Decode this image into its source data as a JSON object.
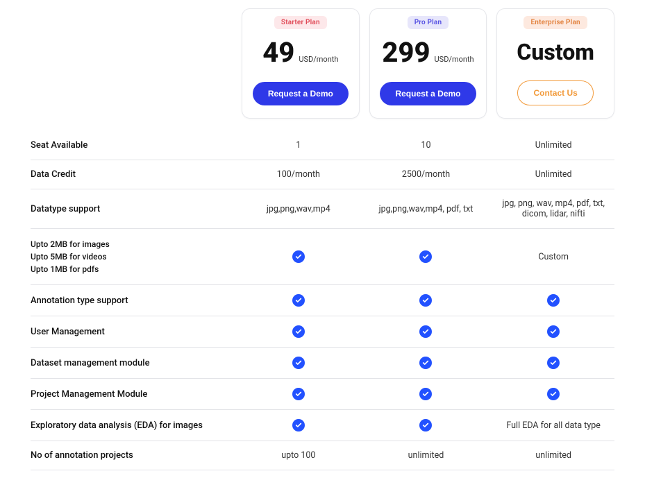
{
  "plans": {
    "starter": {
      "badge": "Starter Plan",
      "price": "49",
      "unit": "USD/month",
      "cta": "Request a Demo"
    },
    "pro": {
      "badge": "Pro Plan",
      "price": "299",
      "unit": "USD/month",
      "cta": "Request a Demo"
    },
    "enterprise": {
      "badge": "Enterprise Plan",
      "price": "Custom",
      "cta": "Contact Us"
    }
  },
  "rows": [
    {
      "label": "Seat Available",
      "starter": "1",
      "pro": "10",
      "enterprise": "Unlimited"
    },
    {
      "label": "Data Credit",
      "starter": "100/month",
      "pro": "2500/month",
      "enterprise": "Unlimited"
    },
    {
      "label": "Datatype support",
      "starter": "jpg,png,wav,mp4",
      "pro": "jpg,png,wav,mp4, pdf, txt",
      "enterprise": "jpg, png, wav, mp4, pdf, txt, dicom, lidar, nifti"
    },
    {
      "label": "Upto 2MB for images\nUpto 5MB for videos\nUpto 1MB for pdfs",
      "starter": "CHECK",
      "pro": "CHECK",
      "enterprise": "Custom"
    },
    {
      "label": "Annotation type support",
      "starter": "CHECK",
      "pro": "CHECK",
      "enterprise": "CHECK"
    },
    {
      "label": "User Management",
      "starter": "CHECK",
      "pro": "CHECK",
      "enterprise": "CHECK"
    },
    {
      "label": "Dataset management module",
      "starter": "CHECK",
      "pro": "CHECK",
      "enterprise": "CHECK"
    },
    {
      "label": "Project Management Module",
      "starter": "CHECK",
      "pro": "CHECK",
      "enterprise": "CHECK"
    },
    {
      "label": "Exploratory data analysis (EDA) for images",
      "starter": "CHECK",
      "pro": "CHECK",
      "enterprise": "Full EDA for all data type"
    },
    {
      "label": "No of annotation projects",
      "starter": "upto 100",
      "pro": "unlimited",
      "enterprise": "unlimited"
    }
  ]
}
